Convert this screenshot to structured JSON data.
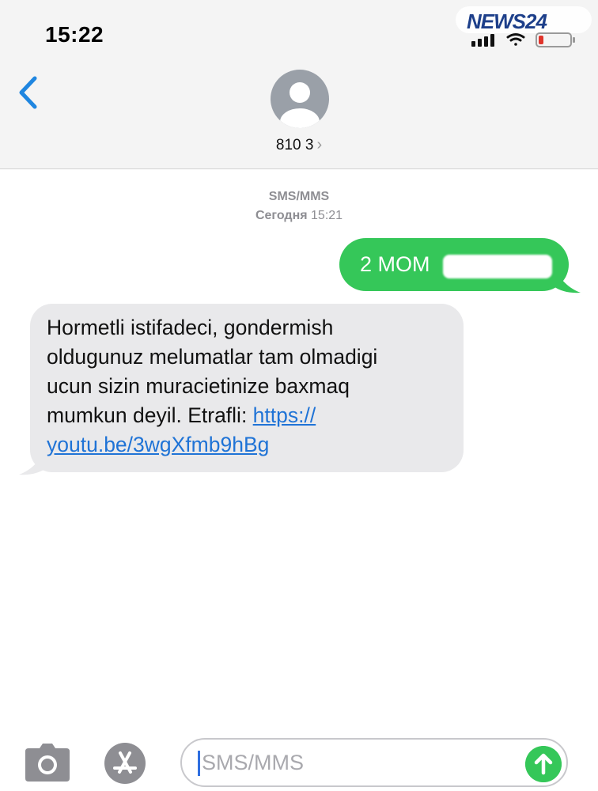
{
  "status_bar": {
    "time": "15:22"
  },
  "watermark": {
    "text": "NEWS24"
  },
  "header": {
    "contact": "810 3",
    "chevron": "›"
  },
  "thread": {
    "service": "SMS/MMS",
    "day": "Сегодня",
    "time": "15:21"
  },
  "messages": {
    "sent": {
      "text": "2 MOM"
    },
    "received": {
      "text": "Hormetli istifadeci, gondermish\noldugunuz melumatlar tam olmadigi\nucun sizin muracietinize baxmaq\nmumkun deyil. Etrafli: ",
      "link_line1": "https://",
      "link_line2": "youtu.be/3wgXfmb9hBg"
    }
  },
  "composer": {
    "placeholder": "SMS/MMS"
  },
  "colors": {
    "sent_bubble": "#35c759",
    "received_bubble": "#e9e9eb",
    "link": "#1f73d6",
    "accent": "#1f86e0"
  },
  "icons": [
    "back-chevron-icon",
    "avatar-icon",
    "camera-icon",
    "app-store-icon",
    "send-arrow-icon",
    "signal-icon",
    "wifi-icon",
    "battery-icon"
  ]
}
